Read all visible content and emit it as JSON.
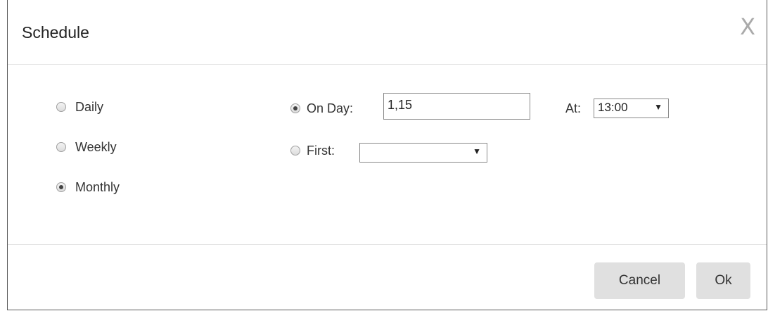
{
  "dialog": {
    "title": "Schedule",
    "close_glyph": "X"
  },
  "frequency": {
    "options": [
      {
        "label": "Daily",
        "checked": false
      },
      {
        "label": "Weekly",
        "checked": false
      },
      {
        "label": "Monthly",
        "checked": true
      }
    ]
  },
  "monthly": {
    "on_day": {
      "label": "On Day:",
      "value": "1,15",
      "checked": true
    },
    "first": {
      "label": "First:",
      "value": "",
      "checked": false
    }
  },
  "time": {
    "label": "At:",
    "value": "13:00"
  },
  "footer": {
    "cancel_label": "Cancel",
    "ok_label": "Ok"
  },
  "icons": {
    "dropdown": "chevron-down-icon",
    "close": "close-icon"
  }
}
